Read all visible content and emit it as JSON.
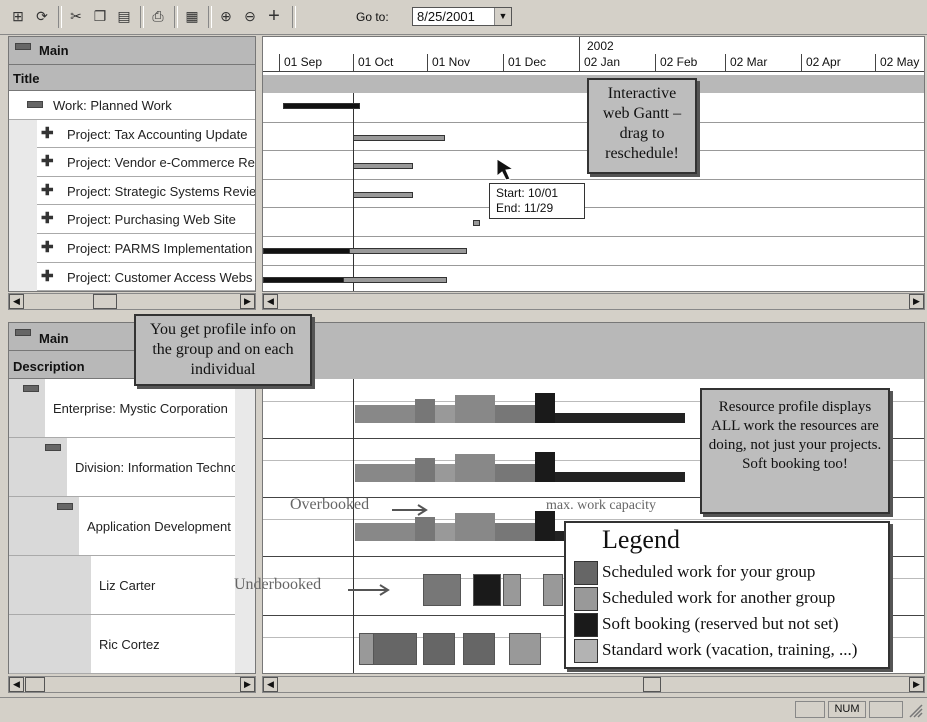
{
  "toolbar": {
    "goto_label": "Go to:",
    "goto_value": "8/25/2001",
    "icons": [
      "outline-icon",
      "refresh-icon",
      "cut-icon",
      "copy-icon",
      "paste-icon",
      "print-icon",
      "calculator-icon",
      "zoom-in-icon",
      "zoom-out-icon",
      "add-icon"
    ]
  },
  "top_panel": {
    "header_main": "Main",
    "header_title": "Title",
    "year_label": "2002",
    "months": [
      "01 Sep",
      "01 Oct",
      "01 Nov",
      "01 Dec",
      "02 Jan",
      "02 Feb",
      "02 Mar",
      "02 Apr",
      "02 May"
    ],
    "rows": [
      {
        "label": "Work: Planned Work",
        "icon": "minus-icon"
      },
      {
        "label": "Project: Tax Accounting Update",
        "icon": "plus-icon"
      },
      {
        "label": "Project: Vendor e-Commerce Re",
        "icon": "plus-icon"
      },
      {
        "label": "Project: Strategic Systems Revie",
        "icon": "plus-icon"
      },
      {
        "label": "Project: Purchasing Web Site",
        "icon": "plus-icon"
      },
      {
        "label": "Project: PARMS Implementation",
        "icon": "plus-icon"
      },
      {
        "label": "Project: Customer Access Webs",
        "icon": "plus-icon"
      }
    ],
    "tooltip": {
      "start": "Start: 10/01",
      "end": "End: 11/29"
    }
  },
  "bottom_panel": {
    "header_main": "Main",
    "header_description": "Description",
    "rows": [
      {
        "label": "Enterprise: Mystic Corporation"
      },
      {
        "label": "Division: Information Techno"
      },
      {
        "label": "Application Development"
      },
      {
        "label": "Liz Carter"
      },
      {
        "label": "Ric Cortez"
      }
    ],
    "annotations": {
      "overbooked": "Overbooked",
      "max_capacity": "max. work capacity",
      "underbooked": "Underbooked"
    }
  },
  "callouts": {
    "gantt": "Interactive web Gantt – drag to reschedule!",
    "profile": "You get profile info on the group and on each individual",
    "resource": "Resource profile displays ALL work the resources are doing, not just your projects. Soft booking too!"
  },
  "legend": {
    "title": "Legend",
    "items": [
      {
        "label": "Scheduled work for your group",
        "color": "#666666"
      },
      {
        "label": "Scheduled work for another group",
        "color": "#999999"
      },
      {
        "label": "Soft booking (reserved but not set)",
        "color": "#1a1a1a"
      },
      {
        "label": "Standard work (vacation, training, ...)",
        "color": "#b3b3b3"
      }
    ]
  },
  "status_bar": {
    "num": "NUM"
  }
}
